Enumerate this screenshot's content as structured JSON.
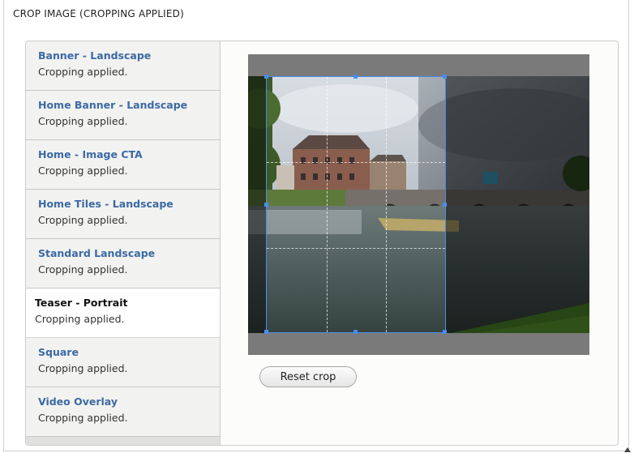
{
  "fieldset": {
    "legend": "CROP IMAGE (CROPPING APPLIED)"
  },
  "tabs": [
    {
      "title": "Banner - Landscape",
      "status": "Cropping applied.",
      "active": false
    },
    {
      "title": "Home Banner - Landscape",
      "status": "Cropping applied.",
      "active": false
    },
    {
      "title": "Home - Image CTA",
      "status": "Cropping applied.",
      "active": false
    },
    {
      "title": "Home Tiles - Landscape",
      "status": "Cropping applied.",
      "active": false
    },
    {
      "title": "Standard Landscape",
      "status": "Cropping applied.",
      "active": false
    },
    {
      "title": "Teaser - Portrait",
      "status": "Cropping applied.",
      "active": true
    },
    {
      "title": "Square",
      "status": "Cropping applied.",
      "active": false
    },
    {
      "title": "Video Overlay",
      "status": "Cropping applied.",
      "active": false
    }
  ],
  "crop_tool": {
    "reset_label": "Reset crop"
  },
  "colors": {
    "link": "#3b6aa5",
    "crop_border": "#4a8cf0",
    "overlay": "#7a7a7a"
  }
}
